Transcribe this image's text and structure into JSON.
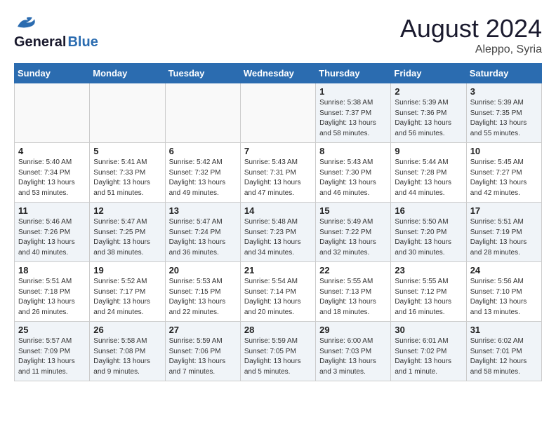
{
  "header": {
    "logo_line1": "General",
    "logo_line2": "Blue",
    "month_year": "August 2024",
    "location": "Aleppo, Syria"
  },
  "weekdays": [
    "Sunday",
    "Monday",
    "Tuesday",
    "Wednesday",
    "Thursday",
    "Friday",
    "Saturday"
  ],
  "weeks": [
    [
      {
        "num": "",
        "info": "",
        "empty": true
      },
      {
        "num": "",
        "info": "",
        "empty": true
      },
      {
        "num": "",
        "info": "",
        "empty": true
      },
      {
        "num": "",
        "info": "",
        "empty": true
      },
      {
        "num": "1",
        "info": "Sunrise: 5:38 AM\nSunset: 7:37 PM\nDaylight: 13 hours\nand 58 minutes.",
        "empty": false
      },
      {
        "num": "2",
        "info": "Sunrise: 5:39 AM\nSunset: 7:36 PM\nDaylight: 13 hours\nand 56 minutes.",
        "empty": false
      },
      {
        "num": "3",
        "info": "Sunrise: 5:39 AM\nSunset: 7:35 PM\nDaylight: 13 hours\nand 55 minutes.",
        "empty": false
      }
    ],
    [
      {
        "num": "4",
        "info": "Sunrise: 5:40 AM\nSunset: 7:34 PM\nDaylight: 13 hours\nand 53 minutes.",
        "empty": false
      },
      {
        "num": "5",
        "info": "Sunrise: 5:41 AM\nSunset: 7:33 PM\nDaylight: 13 hours\nand 51 minutes.",
        "empty": false
      },
      {
        "num": "6",
        "info": "Sunrise: 5:42 AM\nSunset: 7:32 PM\nDaylight: 13 hours\nand 49 minutes.",
        "empty": false
      },
      {
        "num": "7",
        "info": "Sunrise: 5:43 AM\nSunset: 7:31 PM\nDaylight: 13 hours\nand 47 minutes.",
        "empty": false
      },
      {
        "num": "8",
        "info": "Sunrise: 5:43 AM\nSunset: 7:30 PM\nDaylight: 13 hours\nand 46 minutes.",
        "empty": false
      },
      {
        "num": "9",
        "info": "Sunrise: 5:44 AM\nSunset: 7:28 PM\nDaylight: 13 hours\nand 44 minutes.",
        "empty": false
      },
      {
        "num": "10",
        "info": "Sunrise: 5:45 AM\nSunset: 7:27 PM\nDaylight: 13 hours\nand 42 minutes.",
        "empty": false
      }
    ],
    [
      {
        "num": "11",
        "info": "Sunrise: 5:46 AM\nSunset: 7:26 PM\nDaylight: 13 hours\nand 40 minutes.",
        "empty": false
      },
      {
        "num": "12",
        "info": "Sunrise: 5:47 AM\nSunset: 7:25 PM\nDaylight: 13 hours\nand 38 minutes.",
        "empty": false
      },
      {
        "num": "13",
        "info": "Sunrise: 5:47 AM\nSunset: 7:24 PM\nDaylight: 13 hours\nand 36 minutes.",
        "empty": false
      },
      {
        "num": "14",
        "info": "Sunrise: 5:48 AM\nSunset: 7:23 PM\nDaylight: 13 hours\nand 34 minutes.",
        "empty": false
      },
      {
        "num": "15",
        "info": "Sunrise: 5:49 AM\nSunset: 7:22 PM\nDaylight: 13 hours\nand 32 minutes.",
        "empty": false
      },
      {
        "num": "16",
        "info": "Sunrise: 5:50 AM\nSunset: 7:20 PM\nDaylight: 13 hours\nand 30 minutes.",
        "empty": false
      },
      {
        "num": "17",
        "info": "Sunrise: 5:51 AM\nSunset: 7:19 PM\nDaylight: 13 hours\nand 28 minutes.",
        "empty": false
      }
    ],
    [
      {
        "num": "18",
        "info": "Sunrise: 5:51 AM\nSunset: 7:18 PM\nDaylight: 13 hours\nand 26 minutes.",
        "empty": false
      },
      {
        "num": "19",
        "info": "Sunrise: 5:52 AM\nSunset: 7:17 PM\nDaylight: 13 hours\nand 24 minutes.",
        "empty": false
      },
      {
        "num": "20",
        "info": "Sunrise: 5:53 AM\nSunset: 7:15 PM\nDaylight: 13 hours\nand 22 minutes.",
        "empty": false
      },
      {
        "num": "21",
        "info": "Sunrise: 5:54 AM\nSunset: 7:14 PM\nDaylight: 13 hours\nand 20 minutes.",
        "empty": false
      },
      {
        "num": "22",
        "info": "Sunrise: 5:55 AM\nSunset: 7:13 PM\nDaylight: 13 hours\nand 18 minutes.",
        "empty": false
      },
      {
        "num": "23",
        "info": "Sunrise: 5:55 AM\nSunset: 7:12 PM\nDaylight: 13 hours\nand 16 minutes.",
        "empty": false
      },
      {
        "num": "24",
        "info": "Sunrise: 5:56 AM\nSunset: 7:10 PM\nDaylight: 13 hours\nand 13 minutes.",
        "empty": false
      }
    ],
    [
      {
        "num": "25",
        "info": "Sunrise: 5:57 AM\nSunset: 7:09 PM\nDaylight: 13 hours\nand 11 minutes.",
        "empty": false
      },
      {
        "num": "26",
        "info": "Sunrise: 5:58 AM\nSunset: 7:08 PM\nDaylight: 13 hours\nand 9 minutes.",
        "empty": false
      },
      {
        "num": "27",
        "info": "Sunrise: 5:59 AM\nSunset: 7:06 PM\nDaylight: 13 hours\nand 7 minutes.",
        "empty": false
      },
      {
        "num": "28",
        "info": "Sunrise: 5:59 AM\nSunset: 7:05 PM\nDaylight: 13 hours\nand 5 minutes.",
        "empty": false
      },
      {
        "num": "29",
        "info": "Sunrise: 6:00 AM\nSunset: 7:03 PM\nDaylight: 13 hours\nand 3 minutes.",
        "empty": false
      },
      {
        "num": "30",
        "info": "Sunrise: 6:01 AM\nSunset: 7:02 PM\nDaylight: 13 hours\nand 1 minute.",
        "empty": false
      },
      {
        "num": "31",
        "info": "Sunrise: 6:02 AM\nSunset: 7:01 PM\nDaylight: 12 hours\nand 58 minutes.",
        "empty": false
      }
    ]
  ]
}
